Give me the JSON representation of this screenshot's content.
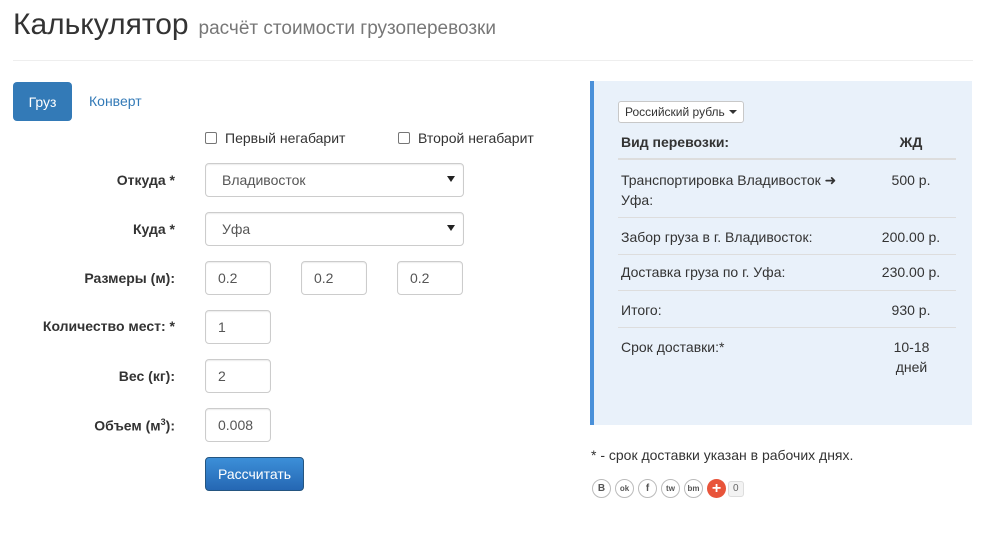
{
  "header": {
    "title": "Калькулятор",
    "subtitle": "расчёт стоимости грузоперевозки"
  },
  "tabs": {
    "active": "Груз",
    "other": "Конверт"
  },
  "checkboxes": {
    "first": "Первый негабарит",
    "second": "Второй негабарит"
  },
  "form": {
    "from_label": "Откуда *",
    "from_value": "Владивосток",
    "to_label": "Куда *",
    "to_value": "Уфа",
    "size_label": "Размеры (м):",
    "size_values": [
      "0.2",
      "0.2",
      "0.2"
    ],
    "places_label": "Количество мест: *",
    "places_value": "1",
    "weight_label": "Вес (кг):",
    "weight_value": "2",
    "volume_label_prefix": "Объем (м",
    "volume_label_sup": "3",
    "volume_label_suffix": "):",
    "volume_value": "0.008",
    "submit": "Рассчитать"
  },
  "result": {
    "currency": "Российский рубль",
    "header_left": "Вид перевозки:",
    "header_right": "ЖД",
    "rows": [
      {
        "left": "Транспортировка Владивосток ➜ Уфа:",
        "right": "500 р."
      },
      {
        "left": "Забор груза в г. Владивосток:",
        "right": "200.00 р."
      },
      {
        "left": "Доставка груза по г. Уфа:",
        "right": "230.00 р."
      },
      {
        "left": "Итого:",
        "right": "930 р."
      },
      {
        "left": "Срок доставки:*",
        "right": "10-18 дней"
      }
    ]
  },
  "footnote": "* - срок доставки указан в рабочих днях.",
  "share": {
    "icons": [
      "В",
      "ok",
      "f",
      "tw",
      "bm"
    ],
    "count": "0"
  }
}
